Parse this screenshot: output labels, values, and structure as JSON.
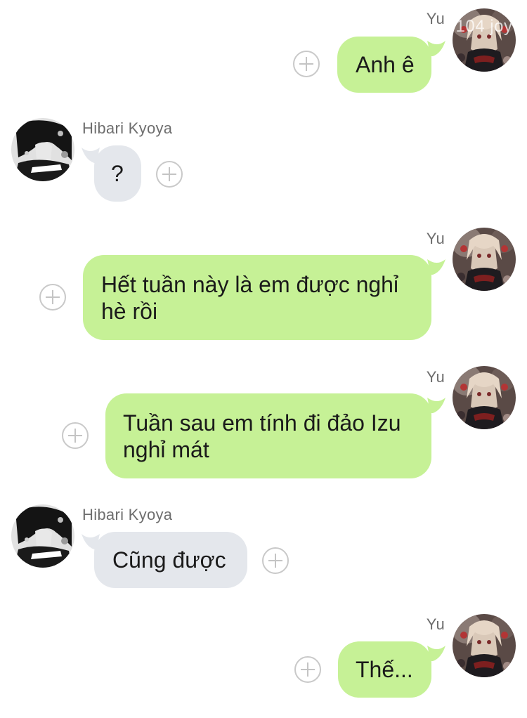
{
  "colors": {
    "sent_bubble": "#c6f196",
    "received_bubble": "#e4e7ec",
    "name_text": "#6e6e6e",
    "react_icon": "#c4c4c4"
  },
  "me": {
    "name": "Yu",
    "avatar_icon": "avatar-yu-icon",
    "avatar_badge": "104 joy"
  },
  "contact": {
    "name": "Hibari Kyoya",
    "avatar_icon": "avatar-hibari-icon"
  },
  "messages": [
    {
      "from": "me",
      "sender": "Yu",
      "text": "Anh ê"
    },
    {
      "from": "contact",
      "sender": "Hibari Kyoya",
      "text": "?"
    },
    {
      "from": "me",
      "sender": "Yu",
      "text": "Hết tuần này là em được nghỉ hè rồi"
    },
    {
      "from": "me",
      "sender": "Yu",
      "text": "Tuần sau em tính đi đảo Izu nghỉ mát"
    },
    {
      "from": "contact",
      "sender": "Hibari Kyoya",
      "text": "Cũng được"
    },
    {
      "from": "me",
      "sender": "Yu",
      "text": "Thế..."
    }
  ]
}
